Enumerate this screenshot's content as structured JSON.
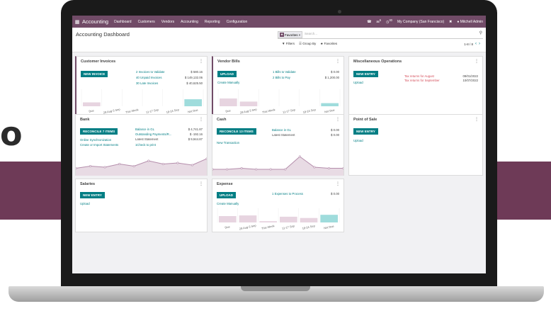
{
  "background": {
    "band_color": "#6e3a57",
    "letter": "o"
  },
  "colors": {
    "brand": "#714b67",
    "button": "#017e84",
    "danger": "#d44c59",
    "bar_past": "#e7d4e0",
    "bar_future": "#9fdcdc",
    "line": "#b48dab"
  },
  "navbar": {
    "apps_icon": "grid-icon",
    "app_name": "Accounting",
    "menus": [
      "Dashboard",
      "Customers",
      "Vendors",
      "Accounting",
      "Reporting",
      "Configuration"
    ],
    "messages_badge": "5",
    "activity_badge": "30",
    "company": "My Company (San Francisco)",
    "user": "Mitchell Admin"
  },
  "control": {
    "title": "Accounting Dashboard",
    "facet": "Favorites",
    "search_placeholder": "Search...",
    "filters_label": "Filters",
    "group_by_label": "Group By",
    "favorites_label": "Favorites",
    "pager": "1-8 / 8"
  },
  "cards": {
    "customer_invoices": {
      "title": "Customer Invoices",
      "button": "NEW INVOICE",
      "rows": [
        {
          "label": "2 Invoices to Validate",
          "amount": "$ 580.16"
        },
        {
          "label": "40 Unpaid Invoices",
          "amount": "$ 149,132.06"
        },
        {
          "label": "30 Late Invoices",
          "amount": "$ 40,625.50"
        }
      ],
      "chart_labels": [
        "Due",
        "28 Aug-3 Sep",
        "This Week",
        "11-17 Sep",
        "18-24 Sep",
        "Not Due"
      ]
    },
    "vendor_bills": {
      "title": "Vendor Bills",
      "button": "UPLOAD",
      "link": "Create Manually",
      "rows": [
        {
          "label": "1 Bills to Validate",
          "amount": "$ 0.00"
        },
        {
          "label": "2 Bills to Pay",
          "amount": "$ 1,200.00"
        }
      ],
      "chart_labels": [
        "Due",
        "28 Aug-3 Sep",
        "This Week",
        "11-17 Sep",
        "18-24 Sep",
        "Not Due"
      ]
    },
    "misc_operations": {
      "title": "Miscellaneous Operations",
      "button": "NEW ENTRY",
      "link": "Upload",
      "rows": [
        {
          "label": "Tax returns for August",
          "date": "09/01/2022"
        },
        {
          "label": "Tax returns for September",
          "date": "10/07/2022"
        }
      ]
    },
    "bank": {
      "title": "Bank",
      "button": "RECONCILE 7 ITEMS",
      "links": [
        "Online Synchronization",
        "Create or Import Statements"
      ],
      "rows": [
        {
          "label": "Balance in GL",
          "amount": "$ 4,741.87"
        },
        {
          "label": "Outstanding Payments/R...",
          "amount": "$ -192.16"
        },
        {
          "label": "Latest Statement",
          "amount": "$ 9,944.87"
        },
        {
          "label": "1Check to print",
          "amount": ""
        }
      ]
    },
    "cash": {
      "title": "Cash",
      "button": "RECONCILE 13 ITEMS",
      "link": "New Transaction",
      "rows": [
        {
          "label": "Balance in GL",
          "amount": "$ 0.00"
        },
        {
          "label": "Latest Statement",
          "amount": "$ 0.00"
        }
      ]
    },
    "point_of_sale": {
      "title": "Point of Sale",
      "button": "NEW ENTRY",
      "link": "Upload"
    },
    "salaries": {
      "title": "Salaries",
      "button": "NEW ENTRY",
      "link": "Upload"
    },
    "expense": {
      "title": "Expense",
      "button": "UPLOAD",
      "link": "Create Manually",
      "rows": [
        {
          "label": "1 Expenses to Process",
          "amount": "$ 0.00"
        }
      ],
      "chart_labels": [
        "Due",
        "28 Aug-3 Sep",
        "This Week",
        "11-17 Sep",
        "18-24 Sep",
        "Not Due"
      ]
    }
  },
  "charts": {
    "invoices_bars": [
      0.25,
      0.0,
      0.0,
      0.0,
      0.0,
      0.45
    ],
    "bills_bars": [
      0.5,
      0.3,
      0.0,
      0.0,
      0.0,
      0.2
    ],
    "expense_bars": [
      0.5,
      0.55,
      0.1,
      0.45,
      0.35,
      0.6
    ],
    "bank_line": [
      0.35,
      0.45,
      0.4,
      0.55,
      0.45,
      0.7,
      0.55,
      0.6,
      0.5,
      0.8
    ],
    "cash_line": [
      0.3,
      0.3,
      0.35,
      0.3,
      0.3,
      0.3,
      0.9,
      0.4,
      0.35,
      0.35
    ]
  }
}
